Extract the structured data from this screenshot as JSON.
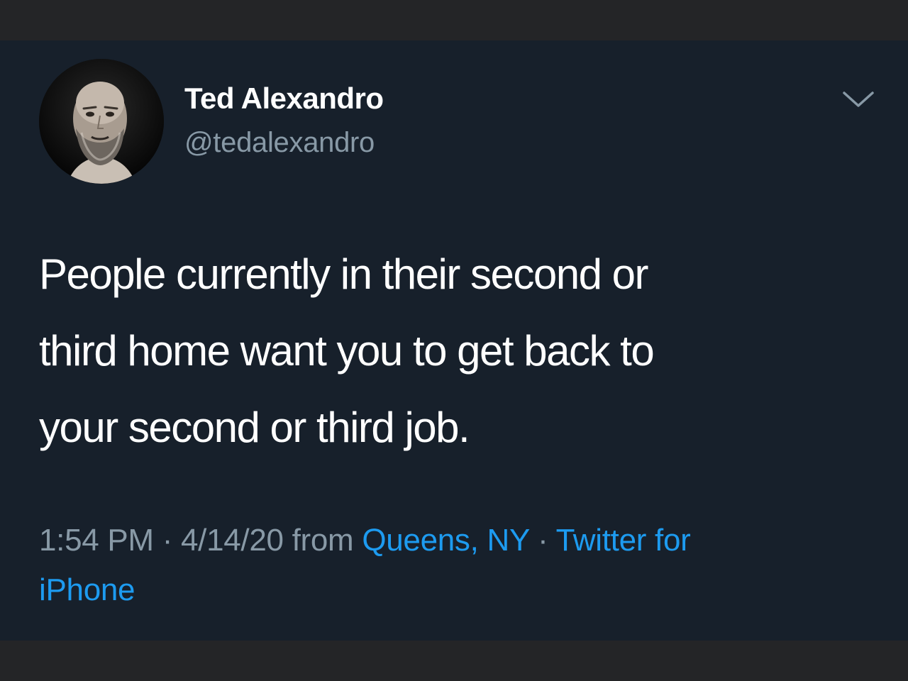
{
  "tweet": {
    "author": {
      "display_name": "Ted Alexandro",
      "handle": "@tedalexandro",
      "avatar_icon": "user-avatar"
    },
    "menu_icon": "chevron-down-icon",
    "text_lines": [
      "People currently in their second or",
      "third home want you to get back to",
      "your second or third job."
    ],
    "meta": {
      "time": "1:54 PM",
      "separator_1": " · ",
      "date": "4/14/20",
      "from_label": " from ",
      "location": "Queens, NY",
      "separator_2": " · ",
      "source_line1": "Twitter for",
      "source_line2": "iPhone"
    }
  },
  "colors": {
    "background": "#17202b",
    "outer_frame": "#242527",
    "text": "#ffffff",
    "secondary_text": "#8899a6",
    "link": "#1d9bf0"
  }
}
